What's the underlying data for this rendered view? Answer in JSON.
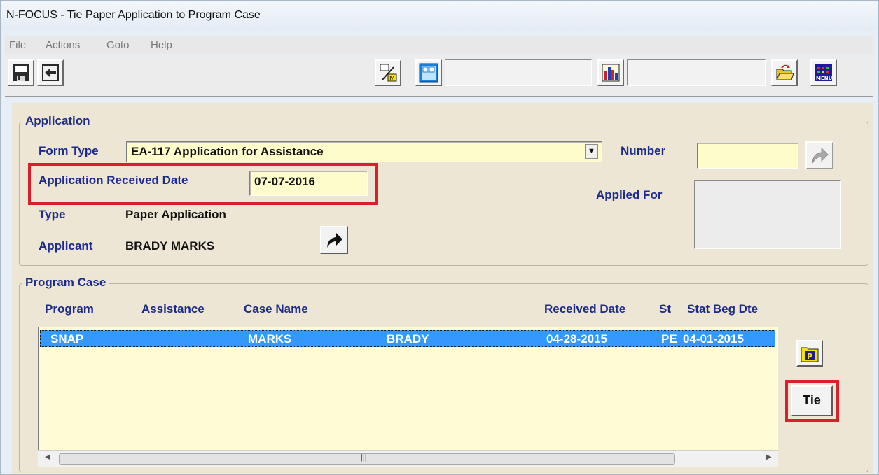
{
  "window": {
    "title": "N-FOCUS - Tie Paper Application to Program Case"
  },
  "menu": [
    "File",
    "Actions",
    "Goto",
    "Help"
  ],
  "icons": {
    "save": "save-icon",
    "exit": "exit-icon",
    "percent_m": "percent-m-icon",
    "layout": "layout-icon",
    "chart": "bar-chart-icon",
    "open_folder": "open-folder-icon",
    "menu": "menu-icon",
    "forward_arrow": "forward-arrow-icon",
    "program_p": "program-p-icon"
  },
  "toolbar": {
    "menu_label": "MENU"
  },
  "application": {
    "title": "Application",
    "form_type_label": "Form Type",
    "form_type_value": "EA-117 Application for Assistance",
    "number_label": "Number",
    "number_value": "",
    "received_date_label": "Application Received Date",
    "received_date_value": "07-07-2016",
    "applied_for_label": "Applied For",
    "type_label": "Type",
    "type_value": "Paper Application",
    "applicant_label": "Applicant",
    "applicant_value": "BRADY MARKS"
  },
  "program_case": {
    "title": "Program Case",
    "columns": {
      "program": "Program",
      "assistance": "Assistance",
      "case_name": "Case Name",
      "received_date": "Received Date",
      "st": "St",
      "stat_beg_dte": "Stat Beg Dte"
    },
    "rows": [
      {
        "program": "SNAP",
        "assistance": "",
        "last_name": "MARKS",
        "first_name": "BRADY",
        "received_date": "04-28-2015",
        "st": "PE",
        "stat_beg_dte": "04-01-2015"
      }
    ],
    "p_button_label": "P",
    "tie_label": "Tie"
  },
  "colors": {
    "label_blue": "#1d2b8a",
    "field_yellow": "#fffccc",
    "selection_blue": "#3399ff",
    "highlight_red": "#dc1f2a",
    "panel_bg": "#ede6d4"
  }
}
